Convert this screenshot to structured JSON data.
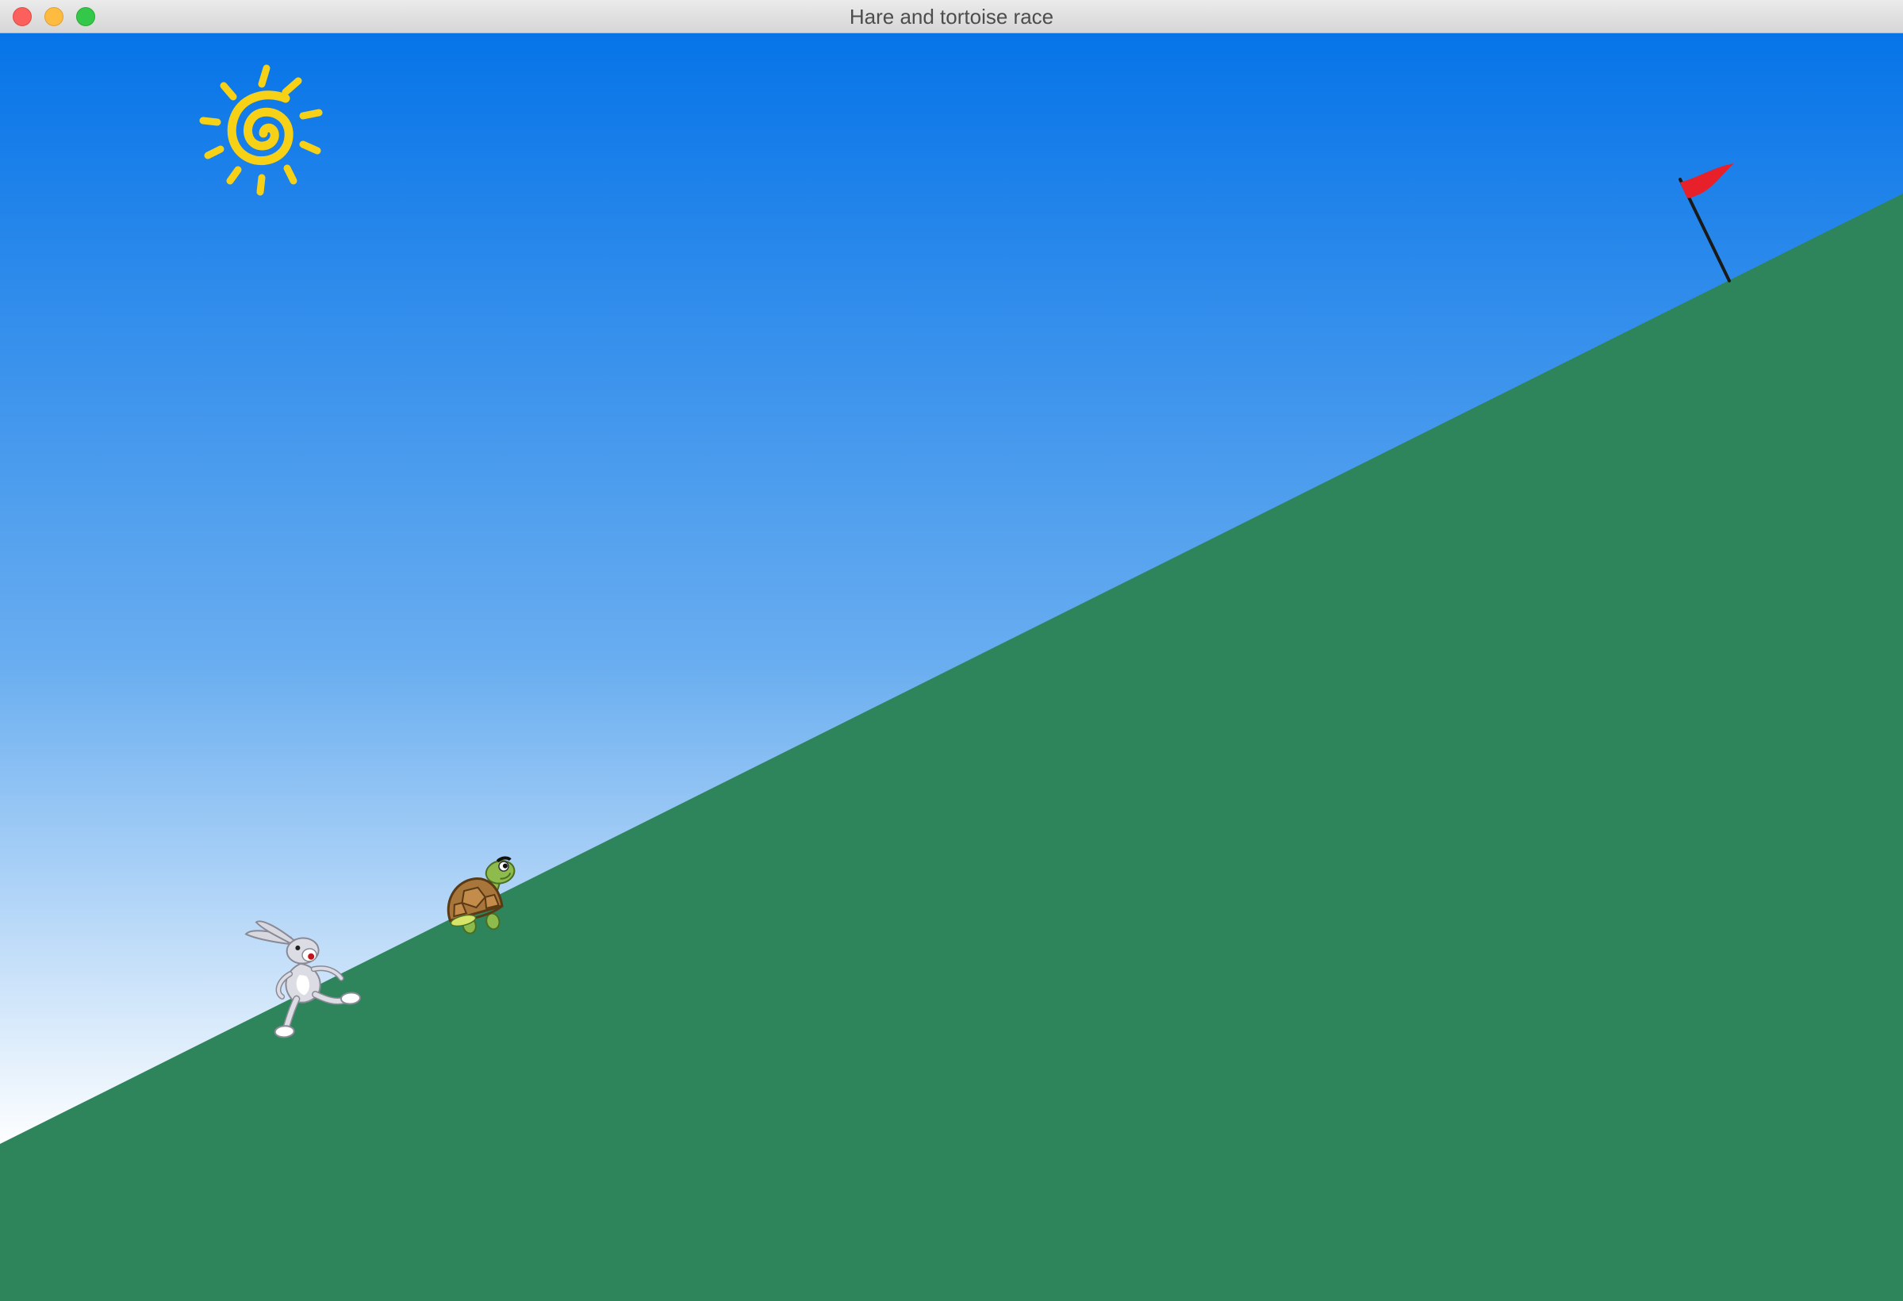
{
  "window": {
    "title": "Hare and tortoise race",
    "controls": [
      "close",
      "minimize",
      "zoom"
    ]
  },
  "scene": {
    "sky_top_color": "#0674e8",
    "sky_bottom_color": "#ffffff",
    "hill_color": "#2e855b",
    "sun": {
      "icon": "spiral-sun",
      "color": "#f7d116"
    },
    "finish_flag": {
      "icon": "red-flag",
      "color": "#e8202a",
      "pole_color": "#1a1a1a"
    },
    "racers": [
      {
        "name": "hare",
        "icon": "hare-running"
      },
      {
        "name": "tortoise",
        "icon": "tortoise-walking"
      }
    ]
  }
}
